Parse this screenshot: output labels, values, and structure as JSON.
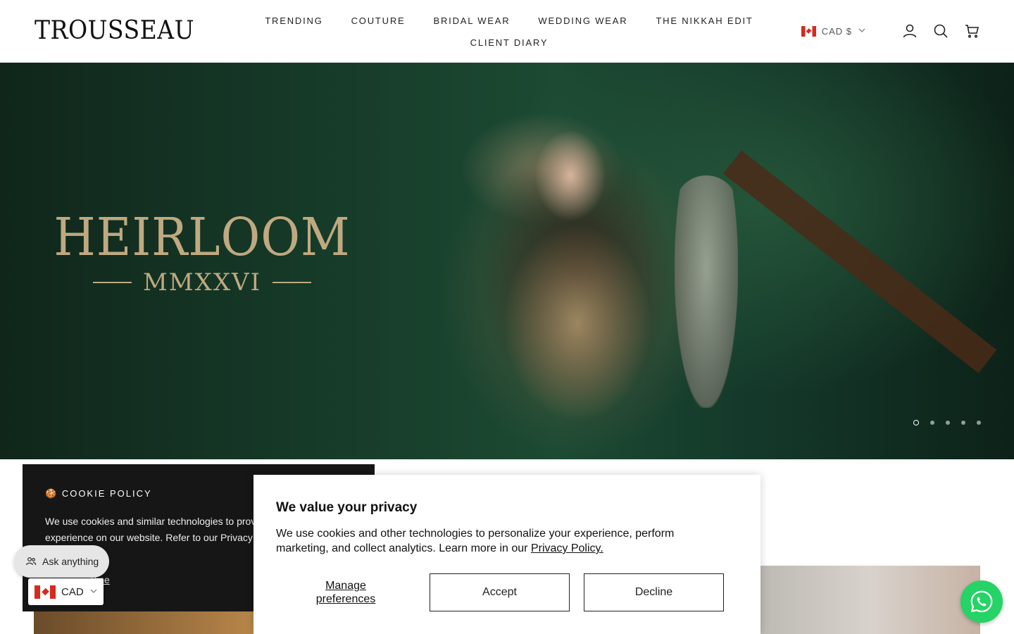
{
  "header": {
    "logo": "TROUSSEAU",
    "nav_row1": [
      "TRENDING",
      "COUTURE",
      "BRIDAL WEAR",
      "WEDDING WEAR",
      "THE NIKKAH EDIT"
    ],
    "nav_row2": [
      "CLIENT DIARY"
    ],
    "currency": "CAD $",
    "icons": [
      "account-icon",
      "search-icon",
      "cart-icon"
    ]
  },
  "hero": {
    "title": "HEIRLOOM",
    "subtitle": "MMXXVI",
    "slide_count": 5,
    "active_slide": 1
  },
  "cookie_policy": {
    "title": "COOKIE POLICY",
    "text_line1": "We use cookies and similar technologies to prov",
    "text_line2": "experience on our website. Refer to our Privacy",
    "decline": "cline"
  },
  "chat": {
    "ask_label": "Ask anything"
  },
  "currency_selector": {
    "value": "CAD"
  },
  "privacy": {
    "title": "We value your privacy",
    "text": "We use cookies and other technologies to personalize your experience, perform marketing, and collect analytics. Learn more in our ",
    "link": "Privacy Policy.",
    "manage": "Manage preferences",
    "accept": "Accept",
    "decline": "Decline"
  },
  "colors": {
    "accent_gold": "#bfa981",
    "whatsapp": "#25d366",
    "dark_panel": "#161616"
  }
}
